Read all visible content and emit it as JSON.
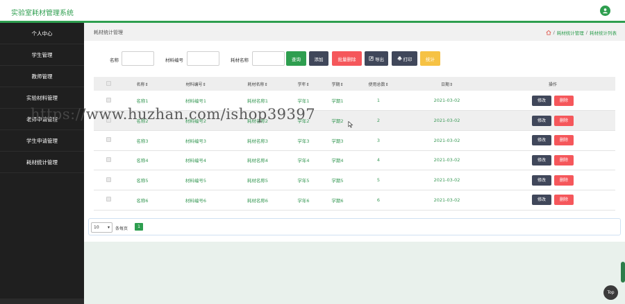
{
  "header": {
    "title": "实验室耗材管理系统"
  },
  "sidebar": {
    "items": [
      {
        "label": "个人中心"
      },
      {
        "label": "学生管理"
      },
      {
        "label": "教师管理"
      },
      {
        "label": "实验材料管理"
      },
      {
        "label": "老师申请管理"
      },
      {
        "label": "学生申请管理"
      },
      {
        "label": "耗材统计管理"
      }
    ]
  },
  "page": {
    "title": "耗材统计管理",
    "breadcrumb": {
      "sep": "/",
      "level1": "耗材统计管理",
      "level2": "耗材统计列表"
    }
  },
  "search": {
    "name_label": "名称",
    "code_label": "材料编号",
    "consumable_label": "耗材名称",
    "name_value": "",
    "code_value": "",
    "consumable_value": ""
  },
  "toolbar": {
    "query": "查询",
    "add": "添加",
    "batch_delete": "批量删除",
    "export": "导出",
    "print": "打印",
    "stats": "统计"
  },
  "table": {
    "headers": [
      "名称",
      "材料编号",
      "耗材名称",
      "学年",
      "学期",
      "使用总数",
      "日期",
      "操作"
    ],
    "sort_glyph": "⇕",
    "edit_label": "修改",
    "delete_label": "删除",
    "rows": [
      [
        "名称1",
        "材料编号1",
        "耗材名称1",
        "学年1",
        "学期1",
        "1",
        "2021-03-02"
      ],
      [
        "名称2",
        "材料编号2",
        "耗材名称2",
        "学年2",
        "学期2",
        "2",
        "2021-03-02"
      ],
      [
        "名称3",
        "材料编号3",
        "耗材名称3",
        "学年3",
        "学期3",
        "3",
        "2021-03-02"
      ],
      [
        "名称4",
        "材料编号4",
        "耗材名称4",
        "学年4",
        "学期4",
        "4",
        "2021-03-02"
      ],
      [
        "名称5",
        "材料编号5",
        "耗材名称5",
        "学年5",
        "学期5",
        "5",
        "2021-03-02"
      ],
      [
        "名称6",
        "材料编号6",
        "耗材名称6",
        "学年6",
        "学期6",
        "6",
        "2021-03-02"
      ]
    ]
  },
  "pagination": {
    "page_size": "10",
    "per_page_label": "条每页",
    "current_page": "1"
  },
  "watermark": "https://www.huzhan.com/ishop39397",
  "back_to_top": "Top",
  "colors": {
    "accent": "#2e9e4f",
    "danger": "#f5575b",
    "dark": "#40475a",
    "warning": "#f6c244"
  }
}
